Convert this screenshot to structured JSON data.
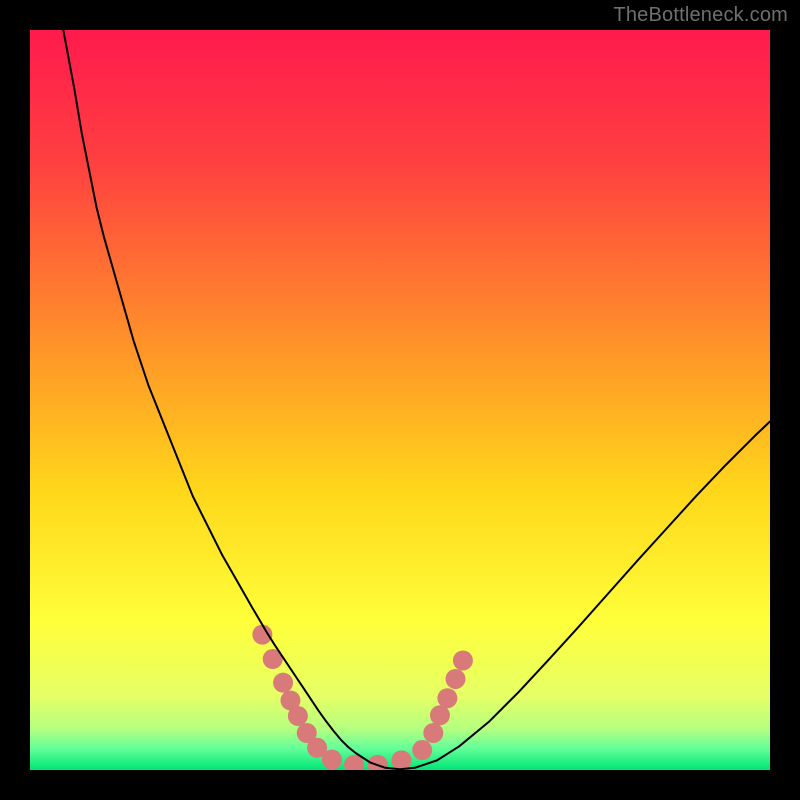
{
  "watermark": "TheBottleneck.com",
  "chart_data": {
    "type": "line",
    "title": "",
    "xlabel": "",
    "ylabel": "",
    "xlim": [
      0,
      100
    ],
    "ylim": [
      0,
      100
    ],
    "background_gradient_stops": [
      {
        "offset": 0.0,
        "color": "#ff1a4d"
      },
      {
        "offset": 0.18,
        "color": "#ff4040"
      },
      {
        "offset": 0.4,
        "color": "#ff8a2b"
      },
      {
        "offset": 0.62,
        "color": "#ffd61a"
      },
      {
        "offset": 0.8,
        "color": "#ffff3a"
      },
      {
        "offset": 0.9,
        "color": "#e6ff66"
      },
      {
        "offset": 0.945,
        "color": "#b4ff80"
      },
      {
        "offset": 0.97,
        "color": "#66ff99"
      },
      {
        "offset": 1.0,
        "color": "#00e676"
      }
    ],
    "series": [
      {
        "name": "bottleneck-curve",
        "color": "#000000",
        "width": 2,
        "x": [
          4.5,
          6,
          7,
          8,
          9,
          10,
          12,
          14,
          16,
          18,
          20,
          22,
          24,
          26,
          28,
          30,
          31,
          32,
          33,
          34,
          35,
          36,
          37,
          38,
          39,
          40,
          41,
          42,
          43,
          44,
          46,
          48,
          50,
          52,
          55,
          58,
          62,
          66,
          70,
          74,
          78,
          82,
          86,
          90,
          94,
          98,
          100
        ],
        "y": [
          100,
          92,
          86,
          81,
          76,
          72,
          65,
          58,
          52,
          47,
          42,
          37,
          33,
          29,
          25.5,
          22,
          20.3,
          18.6,
          17,
          15.5,
          14,
          12.5,
          11,
          9.5,
          8,
          6.6,
          5.3,
          4.1,
          3.1,
          2.3,
          1,
          0.3,
          0.1,
          0.3,
          1.3,
          3.2,
          6.5,
          10.5,
          14.8,
          19.2,
          23.7,
          28.2,
          32.6,
          37,
          41.2,
          45.2,
          47.1
        ]
      }
    ],
    "markers": {
      "name": "highlight-dots",
      "color": "#d97a7a",
      "radius": 10,
      "points": [
        {
          "x": 31.4,
          "y": 18.3
        },
        {
          "x": 32.8,
          "y": 15.0
        },
        {
          "x": 34.2,
          "y": 11.8
        },
        {
          "x": 35.2,
          "y": 9.4
        },
        {
          "x": 36.2,
          "y": 7.3
        },
        {
          "x": 37.4,
          "y": 5.0
        },
        {
          "x": 38.8,
          "y": 3.0
        },
        {
          "x": 40.8,
          "y": 1.4
        },
        {
          "x": 43.8,
          "y": 0.7
        },
        {
          "x": 47.0,
          "y": 0.7
        },
        {
          "x": 50.2,
          "y": 1.3
        },
        {
          "x": 53.0,
          "y": 2.7
        },
        {
          "x": 54.5,
          "y": 5.0
        },
        {
          "x": 55.4,
          "y": 7.4
        },
        {
          "x": 56.4,
          "y": 9.7
        },
        {
          "x": 57.5,
          "y": 12.3
        },
        {
          "x": 58.5,
          "y": 14.8
        }
      ]
    }
  }
}
